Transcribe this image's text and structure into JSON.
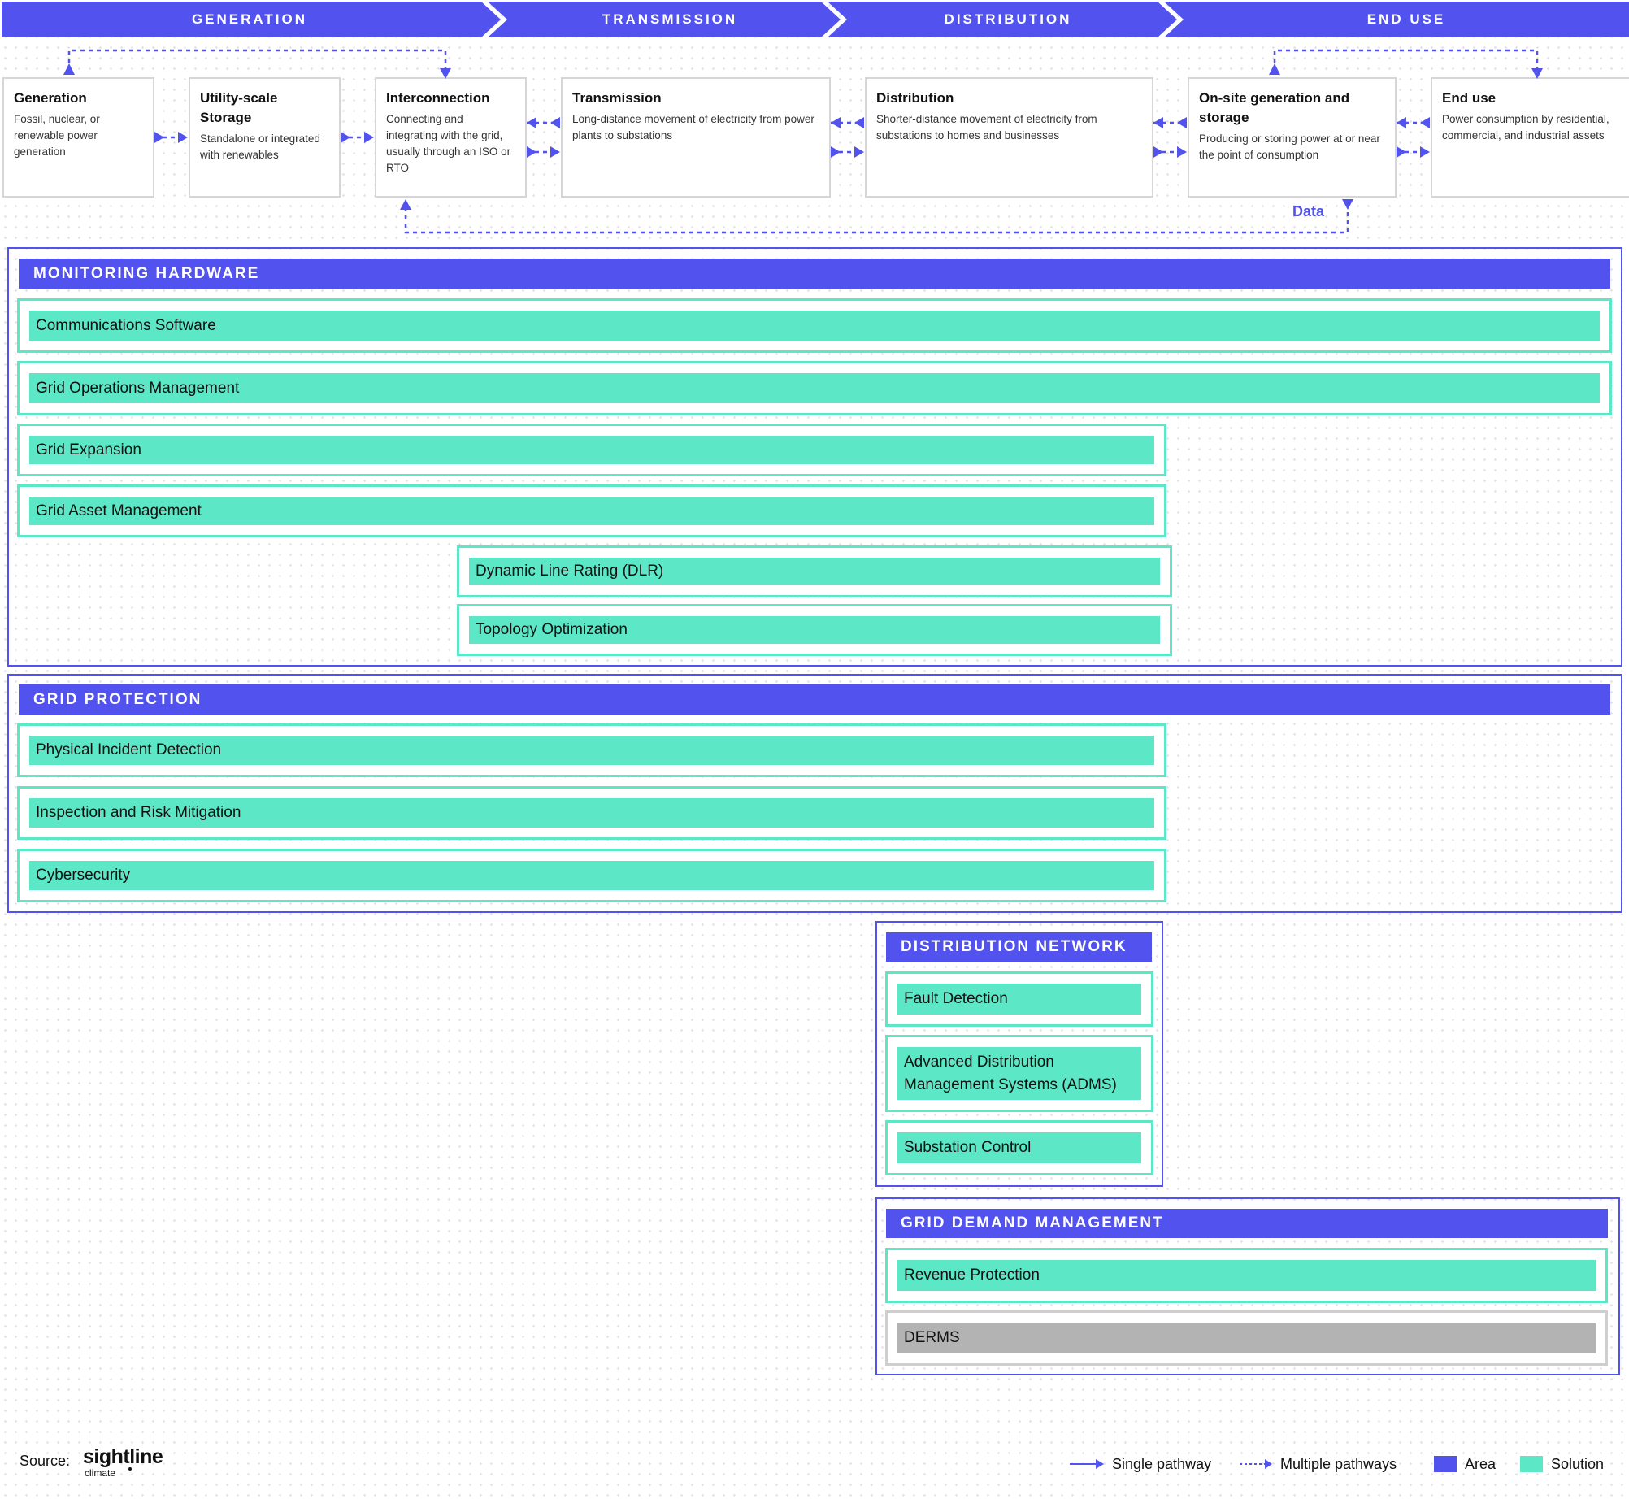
{
  "stages": [
    "GENERATION",
    "TRANSMISSION",
    "DISTRIBUTION",
    "END USE"
  ],
  "process": [
    {
      "title": "Generation",
      "desc": "Fossil, nuclear, or renewable power generation"
    },
    {
      "title": "Utility-scale Storage",
      "desc": "Standalone or integrated with renewables"
    },
    {
      "title": "Interconnection",
      "desc": "Connecting and integrating with the grid, usually through an ISO or RTO"
    },
    {
      "title": "Transmission",
      "desc": "Long-distance movement of electricity from power plants to substations"
    },
    {
      "title": "Distribution",
      "desc": "Shorter-distance movement of electricity from substations to homes and businesses"
    },
    {
      "title": "On-site generation and storage",
      "desc": "Producing or storing power at or near the point of consumption"
    },
    {
      "title": "End use",
      "desc": "Power consumption by residential, commercial, and industrial assets"
    }
  ],
  "data_label": "Data",
  "areas": {
    "monitoring": {
      "title": "MONITORING HARDWARE",
      "solutions": [
        "Communications Software",
        "Grid Operations Management",
        "Grid Expansion",
        "Grid Asset Management",
        "Dynamic Line Rating (DLR)",
        "Topology Optimization"
      ]
    },
    "protection": {
      "title": "GRID PROTECTION",
      "solutions": [
        "Physical Incident Detection",
        "Inspection and Risk Mitigation",
        "Cybersecurity"
      ]
    },
    "distribution": {
      "title": "DISTRIBUTION NETWORK",
      "solutions": [
        "Fault Detection",
        "Advanced Distribution Management Systems (ADMS)",
        "Substation Control"
      ]
    },
    "demand": {
      "title": "GRID DEMAND MANAGEMENT",
      "solutions": [
        "Revenue Protection",
        "DERMS"
      ]
    }
  },
  "footer": {
    "source_label": "Source:",
    "logo_text": "sightline",
    "logo_sub": "climate",
    "legend": [
      "Single pathway",
      "Multiple pathways",
      "Area",
      "Solution"
    ]
  },
  "colors": {
    "area": "#5252ef",
    "solution": "#5ce8c6",
    "inactive": "#b3b3b3"
  }
}
